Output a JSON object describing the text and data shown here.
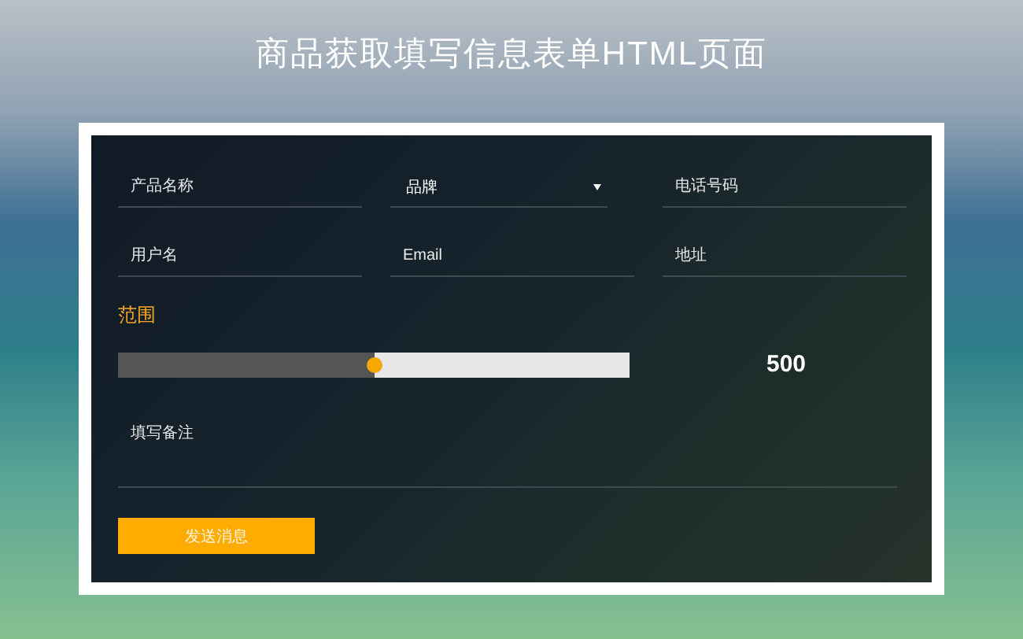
{
  "page_title": "商品获取填写信息表单HTML页面",
  "fields": [
    {
      "kind": "text",
      "placeholder": "产品名称"
    },
    {
      "kind": "select",
      "value": "品牌"
    },
    {
      "kind": "text",
      "placeholder": "电话号码"
    },
    {
      "kind": "text",
      "placeholder": "用户名"
    },
    {
      "kind": "text",
      "placeholder": "Email"
    },
    {
      "kind": "text",
      "placeholder": "地址"
    }
  ],
  "range": {
    "label": "范围",
    "level": 0.5,
    "reading": "500"
  },
  "notes": {
    "placeholder": "填写备注"
  },
  "submit_button": "发送消息"
}
